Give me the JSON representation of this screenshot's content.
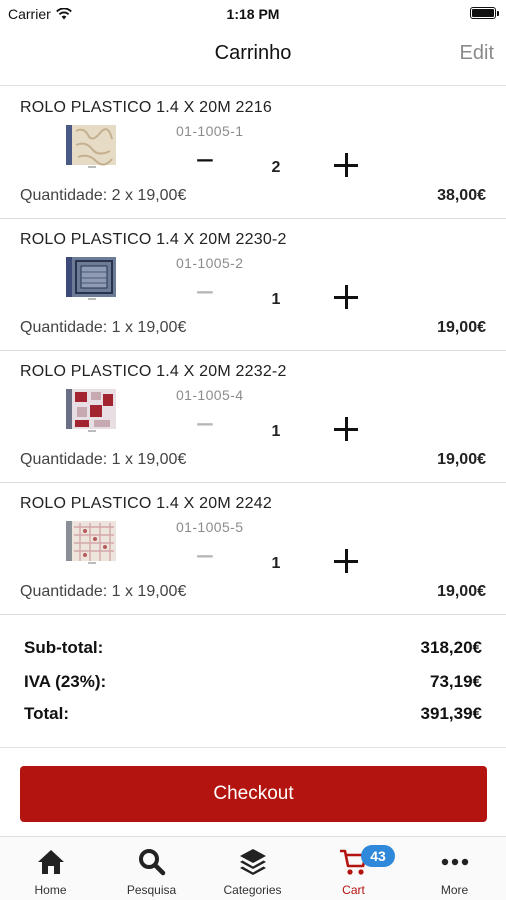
{
  "status_bar": {
    "carrier": "Carrier",
    "time": "1:18 PM"
  },
  "nav": {
    "title": "Carrinho",
    "edit": "Edit"
  },
  "items": [
    {
      "name": "ROLO PLASTICO 1.4 X 20M 2216",
      "sku": "01-1005-1",
      "qty": "2",
      "qty_line": "Quantidade: 2 x 19,00€",
      "total": "38,00€",
      "minus_enabled": true
    },
    {
      "name": "ROLO PLASTICO 1.4 X 20M 2230-2",
      "sku": "01-1005-2",
      "qty": "1",
      "qty_line": "Quantidade: 1 x 19,00€",
      "total": "19,00€",
      "minus_enabled": false
    },
    {
      "name": "ROLO PLASTICO 1.4 X 20M 2232-2",
      "sku": "01-1005-4",
      "qty": "1",
      "qty_line": "Quantidade: 1 x 19,00€",
      "total": "19,00€",
      "minus_enabled": false
    },
    {
      "name": "ROLO PLASTICO 1.4 X 20M 2242",
      "sku": "01-1005-5",
      "qty": "1",
      "qty_line": "Quantidade: 1 x 19,00€",
      "total": "19,00€",
      "minus_enabled": false
    }
  ],
  "qty_controls": {
    "minus": "−"
  },
  "summary": {
    "subtotal_label": "Sub-total:",
    "subtotal_value": "318,20€",
    "tax_label": "IVA (23%):",
    "tax_value": "73,19€",
    "total_label": "Total:",
    "total_value": "391,39€"
  },
  "checkout": {
    "label": "Checkout",
    "color": "#b3140f"
  },
  "tabs": [
    {
      "label": "Home",
      "icon": "home-icon"
    },
    {
      "label": "Pesquisa",
      "icon": "search-icon"
    },
    {
      "label": "Categories",
      "icon": "layers-icon"
    },
    {
      "label": "Cart",
      "icon": "cart-icon",
      "badge": "43",
      "active": true
    },
    {
      "label": "More",
      "icon": "more-icon"
    }
  ],
  "colors": {
    "accent": "#b3140f",
    "badge": "#2f88d9"
  }
}
